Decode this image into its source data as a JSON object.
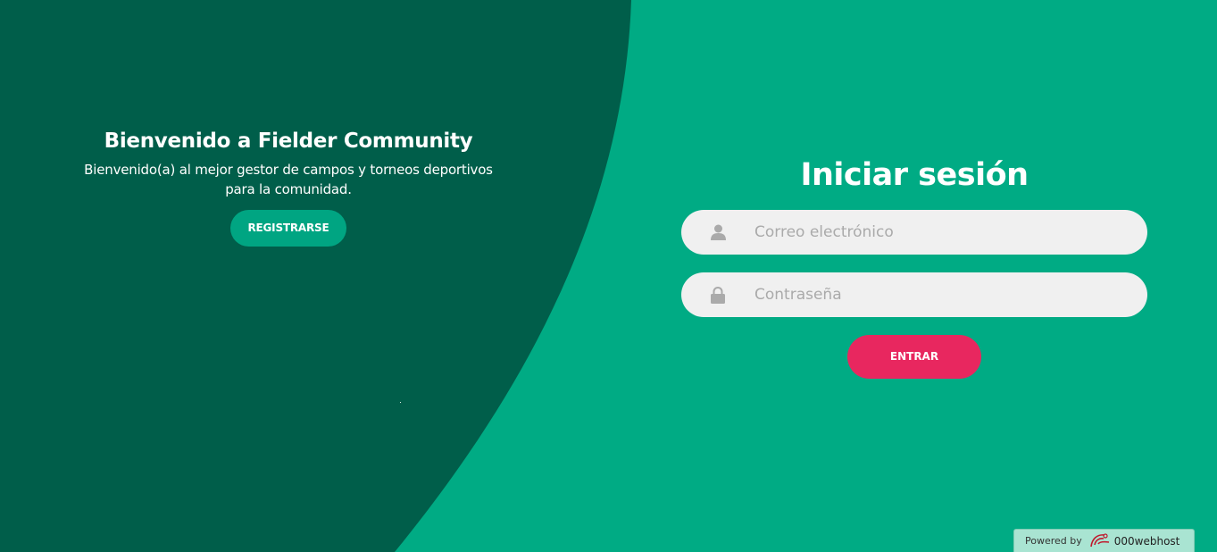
{
  "colors": {
    "background": "#00ab84",
    "dark_panel": "#005e4a",
    "register_button": "#00a582",
    "submit_button": "#e8275f",
    "input_background": "#f0f0f0",
    "icon_color": "#aaaaaa"
  },
  "welcome": {
    "title": "Bienvenido a Fielder Community",
    "subtitle": "Bienvenido(a) al mejor gestor de campos y torneos deportivos para la comunidad.",
    "register_label": "REGISTRARSE"
  },
  "login": {
    "title": "Iniciar sesión",
    "email_icon": "user-icon",
    "email_placeholder": "Correo electrónico",
    "email_value": "",
    "password_icon": "lock-icon",
    "password_placeholder": "Contraseña",
    "password_value": "",
    "submit_label": "ENTRAR"
  },
  "footer": {
    "powered_label": "Powered by",
    "host_logo_icon": "000webhost-logo-icon",
    "host_name": "000webhost"
  }
}
